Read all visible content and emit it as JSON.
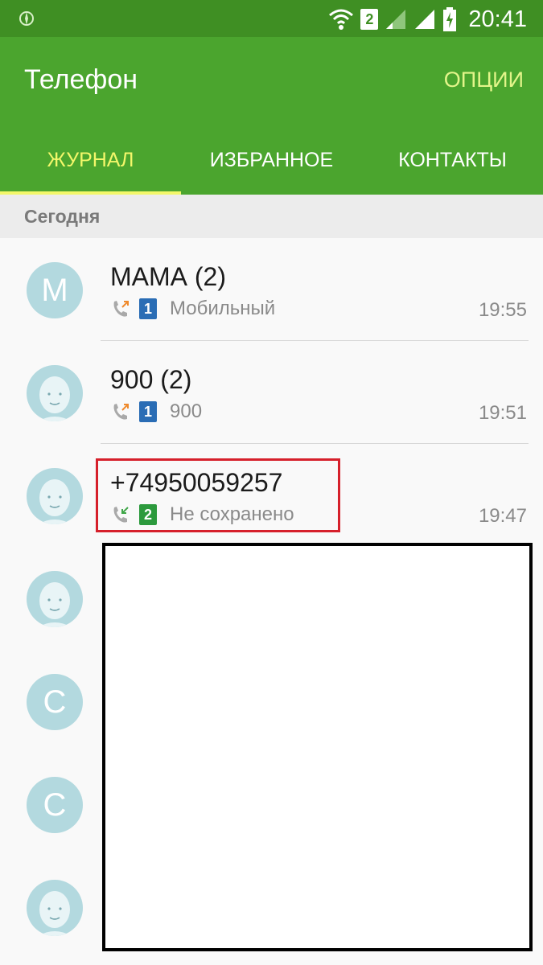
{
  "status_bar": {
    "time": "20:41",
    "sim_badge": "2",
    "icons": [
      "location-icon",
      "wifi-icon",
      "signal-weak-icon",
      "signal-strong-icon",
      "battery-charging-icon"
    ]
  },
  "app": {
    "title": "Телефон",
    "options_label": "ОПЦИИ",
    "accent_color": "#4ba52e",
    "tab_highlight_color": "#f3f76a"
  },
  "tabs": [
    {
      "label": "ЖУРНАЛ",
      "active": true
    },
    {
      "label": "ИЗБРАННОЕ",
      "active": false
    },
    {
      "label": "КОНТАКТЫ",
      "active": false
    }
  ],
  "section": {
    "label": "Сегодня"
  },
  "calls": [
    {
      "avatar": "М",
      "name": "МАМА (2)",
      "direction": "outgoing",
      "sim": "1",
      "label": "Мобильный",
      "time": "19:55"
    },
    {
      "avatar": "",
      "name": "900 (2)",
      "direction": "outgoing",
      "sim": "1",
      "label": "900",
      "time": "19:51"
    },
    {
      "avatar": "",
      "name": "+74950059257",
      "direction": "incoming",
      "sim": "2",
      "label": "Не сохранено",
      "time": "19:47"
    },
    {
      "avatar": "",
      "name": "",
      "direction": "",
      "sim": "",
      "label": "",
      "time": ""
    },
    {
      "avatar": "С",
      "name": "",
      "direction": "",
      "sim": "",
      "label": "",
      "time": ""
    },
    {
      "avatar": "С",
      "name": "",
      "direction": "",
      "sim": "",
      "label": "",
      "time": ""
    },
    {
      "avatar": "",
      "name": "",
      "direction": "",
      "sim": "",
      "label": "",
      "time": ""
    }
  ]
}
